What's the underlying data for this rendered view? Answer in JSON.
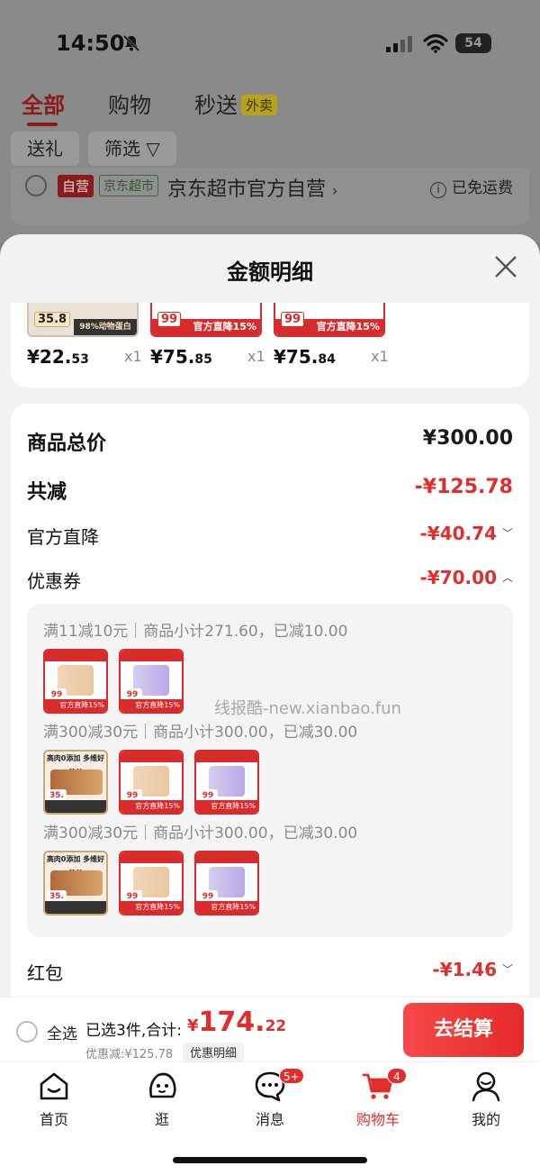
{
  "status_bar": {
    "time": "14:50",
    "battery": "54"
  },
  "tabs": {
    "all": "全部",
    "shopping": "购物",
    "flash": "秒送",
    "takeout_badge": "外卖"
  },
  "chips": {
    "gift": "送礼",
    "filter": "筛选"
  },
  "shop": {
    "self_tag": "自营",
    "market_tag": "京东超市",
    "name": "京东超市官方自营",
    "shipping": "已免运费"
  },
  "sheet": {
    "title": "金额明细",
    "products": [
      {
        "price_int": "¥22.",
        "price_dec": "53",
        "qty": "x1",
        "tag": "35.8",
        "strip": "98%动物蛋白"
      },
      {
        "price_int": "¥75.",
        "price_dec": "85",
        "qty": "x1",
        "tag": "99",
        "strip": "官方直降15%"
      },
      {
        "price_int": "¥75.",
        "price_dec": "84",
        "qty": "x1",
        "tag": "99",
        "strip": "官方直降15%"
      }
    ],
    "summary": {
      "goods_total_label": "商品总价",
      "goods_total_value": "¥300.00",
      "total_reduce_label": "共减",
      "total_reduce_value": "-¥125.78",
      "official_label": "官方直降",
      "official_value": "-¥40.74",
      "coupon_label": "优惠券",
      "coupon_value": "-¥70.00",
      "redpacket_label": "红包",
      "redpacket_value": "-¥1.46"
    },
    "coupon_rules": [
      "满11减10元｜商品小计271.60，已减10.00",
      "满300减30元｜商品小计300.00，已减30.00",
      "满300减30元｜商品小计300.00，已减30.00"
    ],
    "thumb_text": {
      "badge": "99",
      "strip": "官方直降15%",
      "meat_top": "高肉0添加 多维好营养",
      "meat_badge": "35."
    }
  },
  "watermark": "线报酷-new.xianbao.fun",
  "checkout": {
    "select_all": "全选",
    "selected": "已选3件,合计:",
    "currency": "¥",
    "total_int": "174.",
    "total_dec": "22",
    "discount": "优惠减:¥125.78",
    "detail_link": "优惠明细",
    "pay": "去结算"
  },
  "nav": {
    "home": "首页",
    "browse": "逛",
    "messages": "消息",
    "messages_badge": "5+",
    "cart": "购物车",
    "cart_badge": "4",
    "mine": "我的"
  },
  "colors": {
    "accent": "#e22d2d",
    "brand_dark": "#8b1a1a"
  }
}
